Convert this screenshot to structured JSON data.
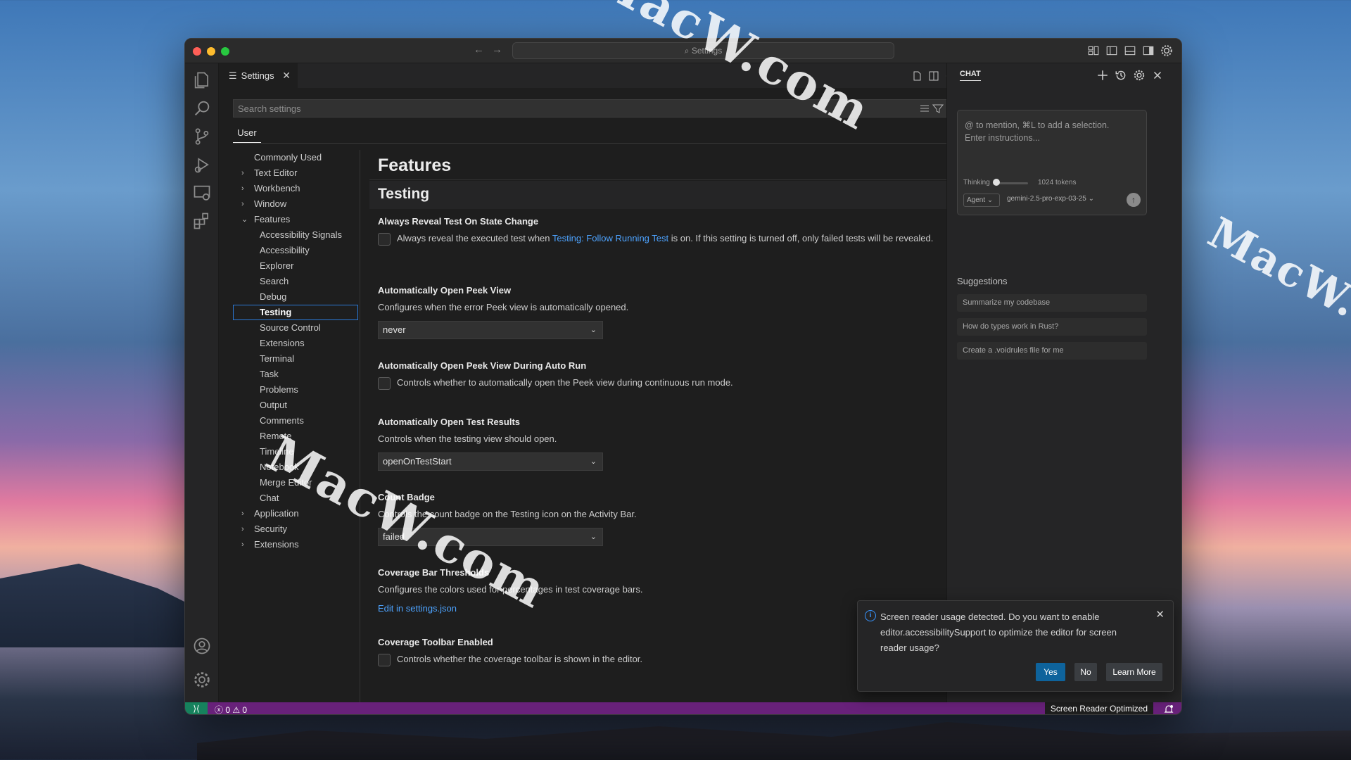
{
  "window": {
    "command_center": "Settings"
  },
  "editor": {
    "tab_label": "Settings",
    "tab_close": "✕",
    "search_placeholder": "Search settings",
    "scope_tab": "User"
  },
  "toc": {
    "items": [
      {
        "label": "Commonly Used",
        "level": 1,
        "expanded": false,
        "has_chevron": false
      },
      {
        "label": "Text Editor",
        "level": 1,
        "has_chevron": true,
        "expanded": false
      },
      {
        "label": "Workbench",
        "level": 1,
        "has_chevron": true,
        "expanded": false
      },
      {
        "label": "Window",
        "level": 1,
        "has_chevron": true,
        "expanded": false
      },
      {
        "label": "Features",
        "level": 1,
        "has_chevron": true,
        "expanded": true
      },
      {
        "label": "Accessibility Signals",
        "level": 2
      },
      {
        "label": "Accessibility",
        "level": 2
      },
      {
        "label": "Explorer",
        "level": 2
      },
      {
        "label": "Search",
        "level": 2
      },
      {
        "label": "Debug",
        "level": 2
      },
      {
        "label": "Testing",
        "level": 2,
        "active": true
      },
      {
        "label": "Source Control",
        "level": 2
      },
      {
        "label": "Extensions",
        "level": 2
      },
      {
        "label": "Terminal",
        "level": 2
      },
      {
        "label": "Task",
        "level": 2
      },
      {
        "label": "Problems",
        "level": 2
      },
      {
        "label": "Output",
        "level": 2
      },
      {
        "label": "Comments",
        "level": 2
      },
      {
        "label": "Remote",
        "level": 2
      },
      {
        "label": "Timeline",
        "level": 2
      },
      {
        "label": "Notebook",
        "level": 2
      },
      {
        "label": "Merge Editor",
        "level": 2
      },
      {
        "label": "Chat",
        "level": 2
      },
      {
        "label": "Application",
        "level": 1,
        "has_chevron": true,
        "expanded": false
      },
      {
        "label": "Security",
        "level": 1,
        "has_chevron": true,
        "expanded": false
      },
      {
        "label": "Extensions",
        "level": 1,
        "has_chevron": true,
        "expanded": false
      }
    ]
  },
  "content": {
    "section": "Features",
    "subsection": "Testing",
    "settings": [
      {
        "title": "Always Reveal Test On State Change",
        "type": "checkbox",
        "desc_pre": "Always reveal the executed test when ",
        "desc_link": "Testing: Follow Running Test",
        "desc_post": " is on. If this setting is turned off, only failed tests will be revealed."
      },
      {
        "title": "Automatically Open Peek View",
        "type": "dropdown",
        "desc": "Configures when the error Peek view is automatically opened.",
        "value": "never"
      },
      {
        "title": "Automatically Open Peek View During Auto Run",
        "type": "checkbox",
        "desc": "Controls whether to automatically open the Peek view during continuous run mode."
      },
      {
        "title": "Automatically Open Test Results",
        "type": "dropdown",
        "desc": "Controls when the testing view should open.",
        "value": "openOnTestStart"
      },
      {
        "title": "Count Badge",
        "type": "dropdown",
        "desc": "Controls the count badge on the Testing icon on the Activity Bar.",
        "value": "failed"
      },
      {
        "title": "Coverage Bar Thresholds",
        "type": "link",
        "desc": "Configures the colors used for percentages in test coverage bars.",
        "link": "Edit in settings.json"
      },
      {
        "title": "Coverage Toolbar Enabled",
        "type": "checkbox",
        "desc": "Controls whether the coverage toolbar is shown in the editor."
      }
    ]
  },
  "chat": {
    "title": "CHAT",
    "placeholder_line1": "@ to mention, ⌘L to add a selection.",
    "placeholder_line2": "Enter instructions...",
    "thinking_label": "Thinking",
    "tokens": "1024 tokens",
    "mode": "Agent",
    "model": "gemini-2.5-pro-exp-03-25",
    "suggestions_heading": "Suggestions",
    "suggestions": [
      "Summarize my codebase",
      "How do types work in Rust?",
      "Create a .voidrules file for me"
    ]
  },
  "statusbar": {
    "problems": "ⓧ 0 ⚠ 0",
    "screen_reader": "Screen Reader Optimized",
    "color": "#68217a",
    "remote_color": "#16825d"
  },
  "notification": {
    "message": "Screen reader usage detected. Do you want to enable editor.accessibilitySupport to optimize the editor for screen reader usage?",
    "yes": "Yes",
    "no": "No",
    "learn_more": "Learn More"
  },
  "watermark": "MacW.com",
  "colors": {
    "accent": "#2b79d7",
    "link": "#4da3ff",
    "primary_button": "#0e639c"
  }
}
